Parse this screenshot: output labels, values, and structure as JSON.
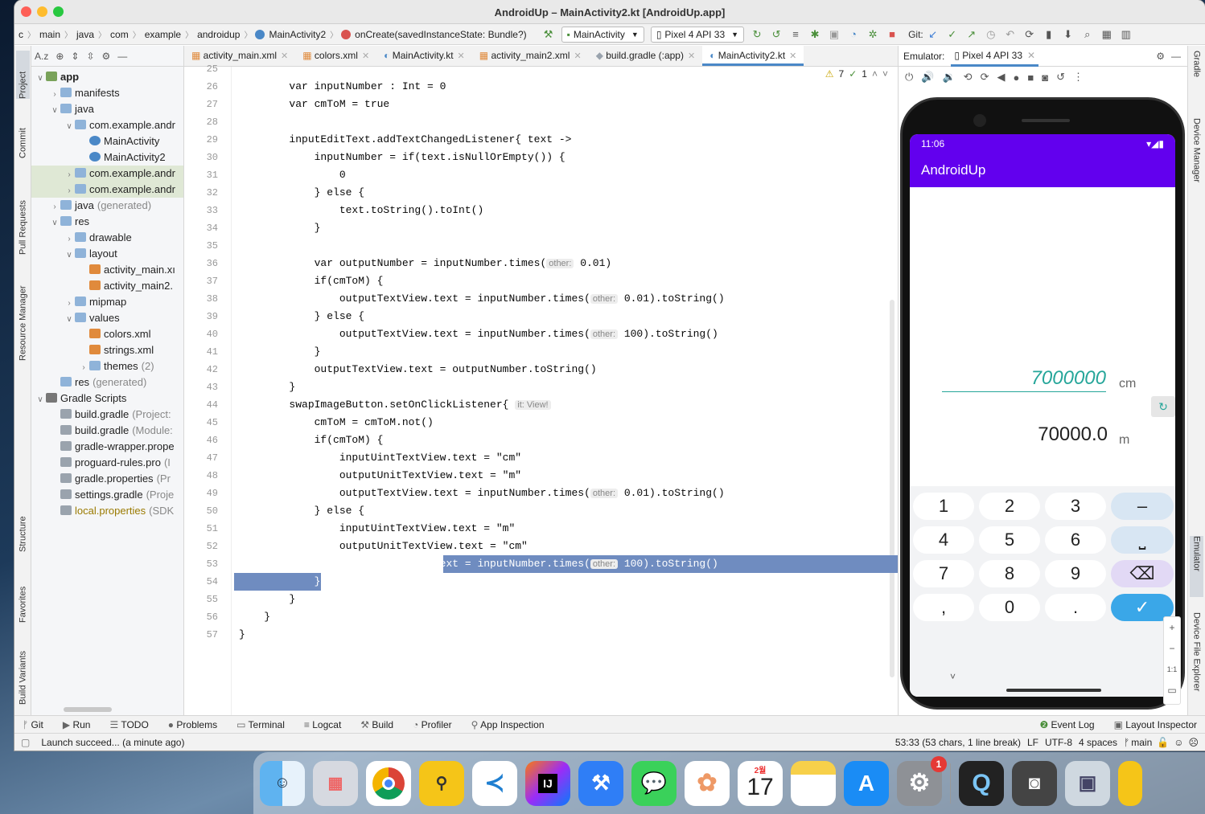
{
  "window": {
    "title": "AndroidUp – MainActivity2.kt [AndroidUp.app]"
  },
  "breadcrumbs": [
    "c",
    "main",
    "java",
    "com",
    "example",
    "androidup",
    "MainActivity2",
    "onCreate(savedInstanceState: Bundle?)"
  ],
  "toolbar": {
    "run_config": "MainActivity",
    "device": "Pixel 4 API 33",
    "git_label": "Git:"
  },
  "left_tabs": [
    "Project",
    "Commit",
    "Pull Requests",
    "Resource Manager",
    "Structure",
    "Favorites",
    "Build Variants"
  ],
  "project_tree": [
    {
      "depth": 0,
      "arrow": "v",
      "label": "app",
      "bold": true
    },
    {
      "depth": 1,
      "arrow": ">",
      "label": "manifests"
    },
    {
      "depth": 1,
      "arrow": "v",
      "label": "java"
    },
    {
      "depth": 2,
      "arrow": "v",
      "label": "com.example.andr"
    },
    {
      "depth": 3,
      "arrow": "",
      "label": "MainActivity"
    },
    {
      "depth": 3,
      "arrow": "",
      "label": "MainActivity2"
    },
    {
      "depth": 2,
      "arrow": ">",
      "label": "com.example.andr",
      "sel": true
    },
    {
      "depth": 2,
      "arrow": ">",
      "label": "com.example.andr",
      "sel": true
    },
    {
      "depth": 1,
      "arrow": ">",
      "label": "java",
      "suffix": "(generated)"
    },
    {
      "depth": 1,
      "arrow": "v",
      "label": "res"
    },
    {
      "depth": 2,
      "arrow": ">",
      "label": "drawable"
    },
    {
      "depth": 2,
      "arrow": "v",
      "label": "layout"
    },
    {
      "depth": 3,
      "arrow": "",
      "label": "activity_main.xı"
    },
    {
      "depth": 3,
      "arrow": "",
      "label": "activity_main2."
    },
    {
      "depth": 2,
      "arrow": ">",
      "label": "mipmap"
    },
    {
      "depth": 2,
      "arrow": "v",
      "label": "values"
    },
    {
      "depth": 3,
      "arrow": "",
      "label": "colors.xml"
    },
    {
      "depth": 3,
      "arrow": "",
      "label": "strings.xml"
    },
    {
      "depth": 3,
      "arrow": ">",
      "label": "themes",
      "suffix": "(2)"
    },
    {
      "depth": 1,
      "arrow": "",
      "label": "res",
      "suffix": "(generated)"
    },
    {
      "depth": 0,
      "arrow": "v",
      "label": "Gradle Scripts"
    },
    {
      "depth": 1,
      "arrow": "",
      "label": "build.gradle",
      "suffix": "(Project:"
    },
    {
      "depth": 1,
      "arrow": "",
      "label": "build.gradle",
      "suffix": "(Module:"
    },
    {
      "depth": 1,
      "arrow": "",
      "label": "gradle-wrapper.prope"
    },
    {
      "depth": 1,
      "arrow": "",
      "label": "proguard-rules.pro",
      "suffix": "(I"
    },
    {
      "depth": 1,
      "arrow": "",
      "label": "gradle.properties",
      "suffix": "(Pr"
    },
    {
      "depth": 1,
      "arrow": "",
      "label": "settings.gradle",
      "suffix": "(Proje"
    },
    {
      "depth": 1,
      "arrow": "",
      "label": "local.properties",
      "suffix": "(SDK",
      "yellow": true
    }
  ],
  "editor_tabs": [
    {
      "label": "activity_main.xml"
    },
    {
      "label": "colors.xml"
    },
    {
      "label": "MainActivity.kt"
    },
    {
      "label": "activity_main2.xml"
    },
    {
      "label": "build.gradle (:app)"
    },
    {
      "label": "MainActivity2.kt",
      "active": true
    }
  ],
  "inspection": {
    "warnings": "7",
    "ok": "1"
  },
  "code_lines": [
    {
      "n": "25",
      "t": ""
    },
    {
      "n": "26",
      "t": "        var inputNumber : Int = 0"
    },
    {
      "n": "27",
      "t": "        var cmToM = true"
    },
    {
      "n": "28",
      "t": ""
    },
    {
      "n": "29",
      "t": "        inputEditText.addTextChangedListener{ text ->"
    },
    {
      "n": "30",
      "t": "            inputNumber = if(text.isNullOrEmpty()) {"
    },
    {
      "n": "31",
      "t": "                0"
    },
    {
      "n": "32",
      "t": "            } else {"
    },
    {
      "n": "33",
      "t": "                text.toString().toInt()"
    },
    {
      "n": "34",
      "t": "            }"
    },
    {
      "n": "35",
      "t": ""
    },
    {
      "n": "36",
      "t": "            var outputNumber = inputNumber.times(",
      "hint": "other:",
      "rest": " 0.01)"
    },
    {
      "n": "37",
      "t": "            if(cmToM) {"
    },
    {
      "n": "38",
      "t": "                outputTextView.text = inputNumber.times(",
      "hint": "other:",
      "rest": " 0.01).toString()"
    },
    {
      "n": "39",
      "t": "            } else {"
    },
    {
      "n": "40",
      "t": "                outputTextView.text = inputNumber.times(",
      "hint": "other:",
      "rest": " 100).toString()"
    },
    {
      "n": "41",
      "t": "            }"
    },
    {
      "n": "42",
      "t": "            outputTextView.text = outputNumber.toString()"
    },
    {
      "n": "43",
      "t": "        }"
    },
    {
      "n": "44",
      "t": "        swapImageButton.setOnClickListener{ ",
      "hint": "it: View!",
      "rest": ""
    },
    {
      "n": "45",
      "t": "            cmToM = cmToM.not()"
    },
    {
      "n": "46",
      "t": "            if(cmToM) {"
    },
    {
      "n": "47",
      "t": "                inputUintTextView.text = \"cm\""
    },
    {
      "n": "48",
      "t": "                outputUnitTextView.text = \"m\""
    },
    {
      "n": "49",
      "t": "                outputTextView.text = inputNumber.times(",
      "hint": "other:",
      "rest": " 0.01).toString()"
    },
    {
      "n": "50",
      "t": "            } else {"
    },
    {
      "n": "51",
      "t": "                inputUintTextView.text = \"m\""
    },
    {
      "n": "52",
      "t": "                outputUnitTextView.text = \"cm\""
    },
    {
      "n": "53",
      "t": "                outputTextView.text = inputNumber.times(",
      "hint": "other:",
      "rest": " 100).toString()",
      "selected": true
    },
    {
      "n": "54",
      "t": "            }",
      "selected": true
    },
    {
      "n": "55",
      "t": "        }"
    },
    {
      "n": "56",
      "t": "    }"
    },
    {
      "n": "57",
      "t": "}"
    }
  ],
  "emulator": {
    "label": "Emulator:",
    "device_tab": "Pixel 4 API 33",
    "time": "11:06",
    "app_title": "AndroidUp",
    "input_value": "7000000",
    "input_unit": "cm",
    "output_value": "70000.0",
    "output_unit": "m",
    "keys": [
      [
        "1",
        "2",
        "3",
        "–"
      ],
      [
        "4",
        "5",
        "6",
        "⎵"
      ],
      [
        "7",
        "8",
        "9",
        "⌫"
      ],
      [
        ",",
        "0",
        ".",
        "✓"
      ]
    ]
  },
  "right_tabs": [
    "Gradle",
    "Device Manager",
    "Emulator",
    "Device File Explorer"
  ],
  "bottom_tabs": [
    "Git",
    "Run",
    "TODO",
    "Problems",
    "Terminal",
    "Logcat",
    "Build",
    "Profiler",
    "App Inspection"
  ],
  "bottom_right_tabs": [
    "Event Log",
    "Layout Inspector"
  ],
  "status": {
    "message": "Launch succeed... (a minute ago)",
    "position": "53:33 (53 chars, 1 line break)",
    "line_sep": "LF",
    "encoding": "UTF-8",
    "indent": "4 spaces",
    "branch": "main"
  },
  "dock": {
    "calendar_month": "2월",
    "calendar_day": "17",
    "settings_badge": "1",
    "apps": [
      "Finder",
      "Launchpad",
      "Chrome",
      "Vysor",
      "VS Code",
      "IntelliJ IDEA",
      "Xcode",
      "Messages",
      "Photos",
      "Calendar",
      "Notes",
      "App Store",
      "System Preferences",
      "QuickTime",
      "Screenshot",
      "Preview"
    ]
  },
  "colors": {
    "accent": "#6200ee",
    "selection": "#6f8cc0",
    "teal": "#26a69a"
  }
}
